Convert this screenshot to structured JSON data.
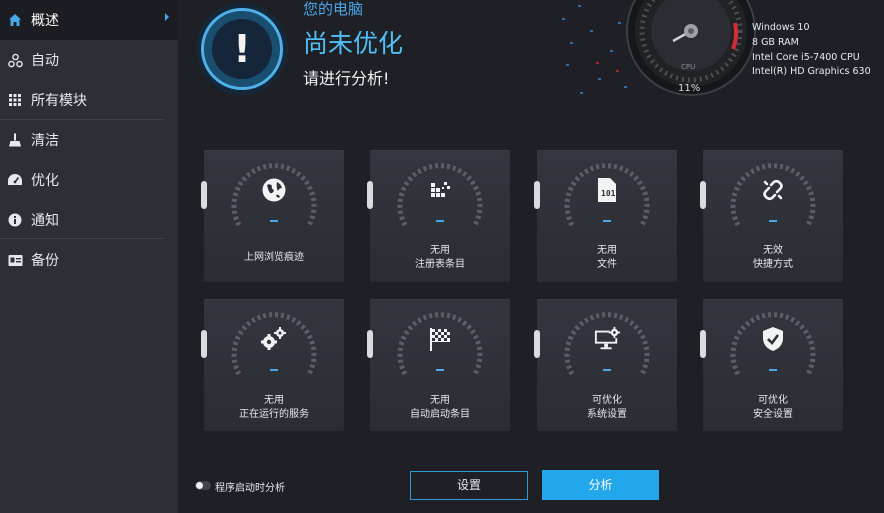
{
  "sidebar": {
    "items": [
      {
        "label": "概述",
        "icon": "home-icon",
        "active": true
      },
      {
        "label": "自动",
        "icon": "network-icon"
      },
      {
        "label": "所有模块",
        "icon": "grid-icon"
      },
      {
        "label": "清洁",
        "icon": "broom-icon"
      },
      {
        "label": "优化",
        "icon": "speedometer-icon"
      },
      {
        "label": "通知",
        "icon": "info-icon"
      },
      {
        "label": "备份",
        "icon": "backup-icon"
      }
    ]
  },
  "header": {
    "subtitle": "您的电脑",
    "title": "尚未优化",
    "description": "请进行分析!"
  },
  "gauge": {
    "label": "CPU",
    "value": "11%"
  },
  "system": {
    "os": "Windows 10",
    "ram": "8 GB RAM",
    "cpu": "Intel Core i5-7400 CPU",
    "gpu": "Intel(R) HD Graphics 630"
  },
  "tiles": [
    {
      "line1": "上网浏览痕迹",
      "line2": "",
      "icon": "globe-icon"
    },
    {
      "line1": "无用",
      "line2": "注册表条目",
      "icon": "registry-icon"
    },
    {
      "line1": "无用",
      "line2": "文件",
      "icon": "file-icon"
    },
    {
      "line1": "无效",
      "line2": "快捷方式",
      "icon": "broken-link-icon"
    },
    {
      "line1": "无用",
      "line2": "正在运行的服务",
      "icon": "gears-icon"
    },
    {
      "line1": "无用",
      "line2": "自动启动条目",
      "icon": "checkered-flag-icon"
    },
    {
      "line1": "可优化",
      "line2": "系统设置",
      "icon": "monitor-settings-icon"
    },
    {
      "line1": "可优化",
      "line2": "安全设置",
      "icon": "shield-check-icon"
    }
  ],
  "footer": {
    "toggle_label": "程序启动时分析",
    "settings_label": "设置",
    "analyze_label": "分析"
  },
  "colors": {
    "accent": "#22a7ec",
    "sidebar_bg": "#2c2f36",
    "main_bg": "#1f2026"
  }
}
